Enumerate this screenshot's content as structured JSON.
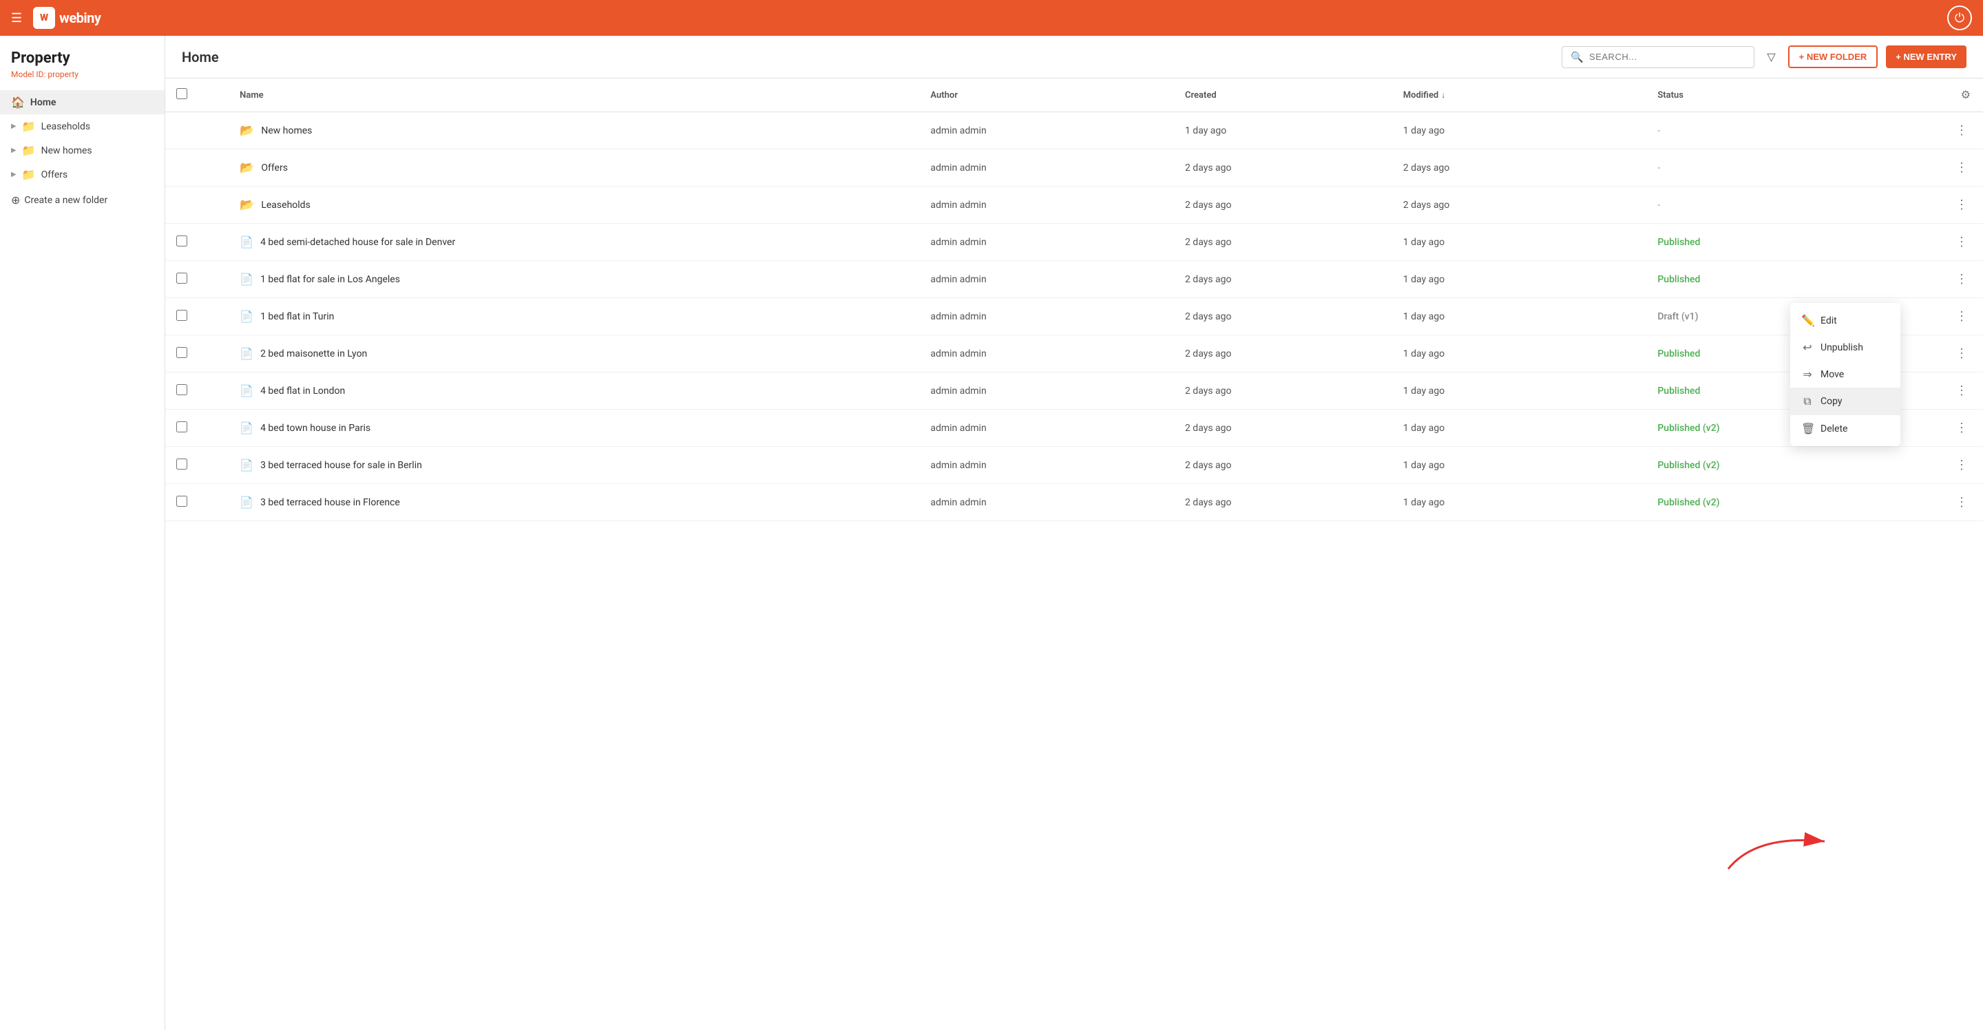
{
  "app": {
    "title": "webiny",
    "logo_letter": "W"
  },
  "sidebar": {
    "model_title": "Property",
    "model_id_label": "Model ID:",
    "model_id_value": "property",
    "nav_items": [
      {
        "id": "home",
        "label": "Home",
        "type": "home",
        "active": true
      },
      {
        "id": "leaseholds",
        "label": "Leaseholds",
        "type": "folder",
        "active": false
      },
      {
        "id": "new-homes",
        "label": "New homes",
        "type": "folder",
        "active": false
      },
      {
        "id": "offers",
        "label": "Offers",
        "type": "folder",
        "active": false
      }
    ],
    "create_folder_label": "Create a new folder"
  },
  "main": {
    "header_title": "Home",
    "search_placeholder": "SEARCH...",
    "btn_new_folder": "+ NEW FOLDER",
    "btn_new_entry": "+ NEW ENTRY"
  },
  "table": {
    "columns": {
      "name": "Name",
      "author": "Author",
      "created": "Created",
      "modified": "Modified",
      "status": "Status"
    },
    "rows": [
      {
        "id": 1,
        "type": "folder",
        "name": "New homes",
        "author": "admin admin",
        "created": "1 day ago",
        "modified": "1 day ago",
        "status": "-"
      },
      {
        "id": 2,
        "type": "folder",
        "name": "Offers",
        "author": "admin admin",
        "created": "2 days ago",
        "modified": "2 days ago",
        "status": "-"
      },
      {
        "id": 3,
        "type": "folder",
        "name": "Leaseholds",
        "author": "admin admin",
        "created": "2 days ago",
        "modified": "2 days ago",
        "status": "-"
      },
      {
        "id": 4,
        "type": "entry",
        "name": "4 bed semi-detached house for sale in Denver",
        "author": "admin admin",
        "created": "2 days ago",
        "modified": "1 day ago",
        "status": "Published"
      },
      {
        "id": 5,
        "type": "entry",
        "name": "1 bed flat for sale in Los Angeles",
        "author": "admin admin",
        "created": "2 days ago",
        "modified": "1 day ago",
        "status": "Published"
      },
      {
        "id": 6,
        "type": "entry",
        "name": "1 bed flat in Turin",
        "author": "admin admin",
        "created": "2 days ago",
        "modified": "1 day ago",
        "status": "Draft (v1)"
      },
      {
        "id": 7,
        "type": "entry",
        "name": "2 bed maisonette in Lyon",
        "author": "admin admin",
        "created": "2 days ago",
        "modified": "1 day ago",
        "status": "Published"
      },
      {
        "id": 8,
        "type": "entry",
        "name": "4 bed flat in London",
        "author": "admin admin",
        "created": "2 days ago",
        "modified": "1 day ago",
        "status": "Published"
      },
      {
        "id": 9,
        "type": "entry",
        "name": "4 bed town house in Paris",
        "author": "admin admin",
        "created": "2 days ago",
        "modified": "1 day ago",
        "status": "Published (v2)"
      },
      {
        "id": 10,
        "type": "entry",
        "name": "3 bed terraced house for sale in Berlin",
        "author": "admin admin",
        "created": "2 days ago",
        "modified": "1 day ago",
        "status": "Published (v2)"
      },
      {
        "id": 11,
        "type": "entry",
        "name": "3 bed terraced house in Florence",
        "author": "admin admin",
        "created": "2 days ago",
        "modified": "1 day ago",
        "status": "Published (v2)"
      }
    ]
  },
  "context_menu": {
    "items": [
      {
        "id": "edit",
        "label": "Edit",
        "icon": "✏️"
      },
      {
        "id": "unpublish",
        "label": "Unpublish",
        "icon": "↩"
      },
      {
        "id": "move",
        "label": "Move",
        "icon": "➡"
      },
      {
        "id": "copy",
        "label": "Copy",
        "icon": "⧉",
        "active": true
      },
      {
        "id": "delete",
        "label": "Delete",
        "icon": "🗑"
      }
    ]
  }
}
